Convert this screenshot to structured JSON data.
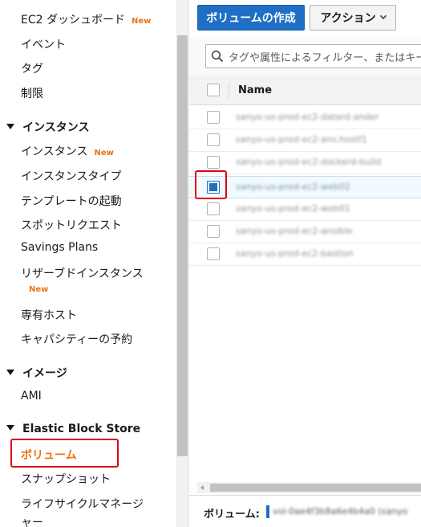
{
  "sidebar": {
    "ec2_dashboard": "EC2 ダッシュボード",
    "ec2_dashboard_badge": "New",
    "events": "イベント",
    "tags": "タグ",
    "limits": "制限",
    "instances_section": "インスタンス",
    "instances": "インスタンス",
    "instances_badge": "New",
    "instance_types": "インスタンスタイプ",
    "launch_templates": "テンプレートの起動",
    "spot_requests": "スポットリクエスト",
    "savings_plans": "Savings Plans",
    "reserved_instances": "リザーブドインスタンス",
    "reserved_instances_badge": "New",
    "dedicated_hosts": "専有ホスト",
    "capacity_reservations": "キャパシティーの予約",
    "images_section": "イメージ",
    "ami": "AMI",
    "ebs_section": "Elastic Block Store",
    "volumes": "ボリューム",
    "snapshots": "スナップショット",
    "lifecycle_manager_line1": "ライフサイクルマネージ",
    "lifecycle_manager_line2": "ャー"
  },
  "toolbar": {
    "create_volume": "ボリュームの作成",
    "actions": "アクション"
  },
  "filter": {
    "placeholder": "タグや属性によるフィルター、またはキー"
  },
  "table": {
    "header_name": "Name",
    "rows": [
      {
        "name": "sanyo-us-prod-ec2-datard-ander",
        "selected": false
      },
      {
        "name": "sanyo-us-prod-ec2-ans.hostf1",
        "selected": false
      },
      {
        "name": "sanyo-us-prod-ec2-dockerd-build",
        "selected": false
      },
      {
        "name": "sanyo-us-prod-ec2-web02",
        "selected": true
      },
      {
        "name": "sanyo-us-prod-ec2-web01",
        "selected": false
      },
      {
        "name": "sanyo-us-prod-ec2-ansible",
        "selected": false
      },
      {
        "name": "sanyo-us-prod-ec2-bastion",
        "selected": false
      }
    ]
  },
  "bottom": {
    "label": "ボリューム:",
    "value": "vol-0ae4f3b8a6e4b4a0 (sanyo"
  },
  "colors": {
    "accent_orange": "#ec7211",
    "primary_blue": "#1f6fc5",
    "highlight_red": "#e0001b"
  }
}
